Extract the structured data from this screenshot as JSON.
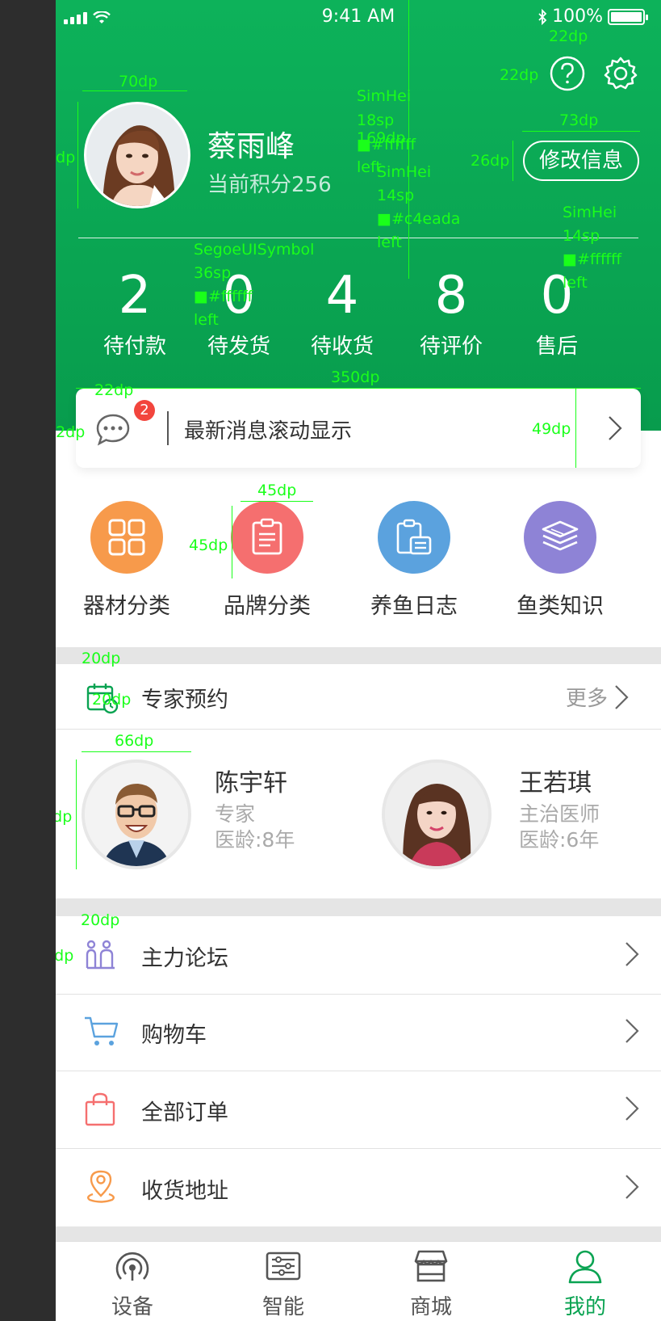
{
  "status_bar": {
    "time": "9:41 AM",
    "battery": "100%"
  },
  "profile": {
    "name": "蔡雨峰",
    "points_label": "当前积分256",
    "edit_button": "修改信息"
  },
  "header_icons": [
    "help-icon",
    "settings-icon"
  ],
  "order_stats": [
    {
      "count": "2",
      "label": "待付款"
    },
    {
      "count": "0",
      "label": "待发货"
    },
    {
      "count": "4",
      "label": "待收货"
    },
    {
      "count": "8",
      "label": "待评价"
    },
    {
      "count": "0",
      "label": "售后"
    }
  ],
  "message_bar": {
    "badge": "2",
    "text": "最新消息滚动显示"
  },
  "categories": [
    {
      "label": "器材分类",
      "color": "#f79a4b",
      "icon": "grid-icon"
    },
    {
      "label": "品牌分类",
      "color": "#f56f6f",
      "icon": "clipboard-list-icon"
    },
    {
      "label": "养鱼日志",
      "color": "#5ba2de",
      "icon": "log-icon"
    },
    {
      "label": "鱼类知识",
      "color": "#8e83d6",
      "icon": "book-stack-icon"
    }
  ],
  "experts_section": {
    "title": "专家预约",
    "more": "更多"
  },
  "experts": [
    {
      "name": "陈宇轩",
      "title": "专家",
      "age": "医龄:8年"
    },
    {
      "name": "王若琪",
      "title": "主治医师",
      "age": "医龄:6年"
    }
  ],
  "menu": [
    {
      "label": "主力论坛",
      "icon": "forum-icon",
      "color": "#8e83d6"
    },
    {
      "label": "购物车",
      "icon": "cart-icon",
      "color": "#5ba2de"
    },
    {
      "label": "全部订单",
      "icon": "shopping-bag-icon",
      "color": "#f56f6f"
    },
    {
      "label": "收货地址",
      "icon": "location-icon",
      "color": "#f79a4b"
    }
  ],
  "tabs": [
    {
      "label": "设备",
      "icon": "device-icon",
      "active": false
    },
    {
      "label": "智能",
      "icon": "smart-icon",
      "active": false
    },
    {
      "label": "商城",
      "icon": "store-icon",
      "active": false
    },
    {
      "label": "我的",
      "icon": "user-icon",
      "active": true
    }
  ],
  "colors": {
    "primary": "#0aa352",
    "secondary_text": "#c4eada",
    "white": "#ffffff"
  },
  "annotations": {
    "avatar_w": "70dp",
    "avatar_h": "70dp",
    "header_h": "111dp",
    "name_font": "SimHei",
    "name_size": "18sp",
    "name_color": "■#ffffff",
    "name_align": "left",
    "gap_169": "169dp",
    "points_font": "SimHei",
    "points_size": "14sp",
    "points_color": "■#c4eada",
    "points_align": "left",
    "icon_w": "22dp",
    "icon_h": "22dp",
    "edit_w": "73dp",
    "edit_h": "26dp",
    "edit_font": "SimHei",
    "edit_size": "14sp",
    "edit_color": "■#ffffff",
    "edit_align": "left",
    "stat_font": "SegoeUISymbol",
    "stat_size": "36sp",
    "stat_color": "■#ffffff",
    "stat_align": "left",
    "msg_w": "350dp",
    "msg_icon_w": "22dp",
    "msg_icon_h": "22dp",
    "msg_h": "49dp",
    "cat_w": "45dp",
    "cat_h": "45dp",
    "sec_icon_w": "20dp",
    "sec_icon_h": "20dp",
    "exp_w": "66dp",
    "exp_h": "66dp",
    "forum_w": "20dp",
    "forum_h": "20dp"
  }
}
